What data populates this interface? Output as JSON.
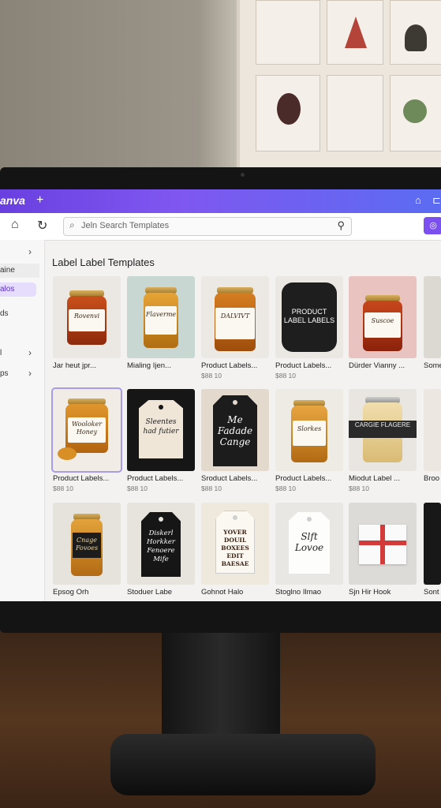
{
  "app": {
    "brand": "anva",
    "new_tab": "+",
    "title_icons": [
      "home-icon",
      "share-icon"
    ],
    "accent": "#7b4ff0"
  },
  "toolbar": {
    "home_icon": "⌂",
    "reload_icon": "↻",
    "search_placeholder": "Jeln Search Templates",
    "search_icon": "search-icon"
  },
  "sidebar": {
    "items": [
      {
        "label": "",
        "chevron": "›"
      },
      {
        "label": "aine",
        "chevron": ""
      },
      {
        "label": "alos",
        "chevron": ""
      },
      {
        "label": "ds",
        "chevron": ""
      },
      {
        "label": "l",
        "chevron": "›"
      },
      {
        "label": "ps",
        "chevron": "›"
      }
    ]
  },
  "main": {
    "heading": "Label Label Templates",
    "cards": [
      {
        "title": "Jar heut jpr...",
        "price": "",
        "art": "Rovenvi"
      },
      {
        "title": "Mialing Ijen...",
        "price": "",
        "art": "Flaverme"
      },
      {
        "title": "Product Labels...",
        "price": "$88 10",
        "art": "DALVIVT"
      },
      {
        "title": "Product Labels...",
        "price": "$88 10",
        "art": "PRODUCT LABEL LABELS"
      },
      {
        "title": "Dürder Vianny ...",
        "price": "",
        "art": "Suscoe"
      },
      {
        "title": "Some",
        "price": "",
        "art": ""
      },
      {
        "title": "Product Labels...",
        "price": "$88 10",
        "art": "Wooloker Honey"
      },
      {
        "title": "Product Labels...",
        "price": "$88 10",
        "art": "Sleentes had futier"
      },
      {
        "title": "Sroduct Labels...",
        "price": "$88 10",
        "art": "Me Fadade Cange"
      },
      {
        "title": "Product Labels...",
        "price": "$88 10",
        "art": "Slorkes"
      },
      {
        "title": "Miodut Label ...",
        "price": "$88 10",
        "art": "CARGIE FLAGERE"
      },
      {
        "title": "Broo",
        "price": "",
        "art": ""
      },
      {
        "title": "Epsog Orh",
        "price": "",
        "art": "Cnage Fovoes"
      },
      {
        "title": "Stoduer Labe",
        "price": "",
        "art": "Diskerl Horkker Fenoere Mife"
      },
      {
        "title": "Gohnot Halo",
        "price": "",
        "art": "YOVER DOUIL BOXEES EDIT BAESAE"
      },
      {
        "title": "Stoglno Ilmao",
        "price": "",
        "art": "Slft Lovoe"
      },
      {
        "title": "Sjn Hir Hook",
        "price": "",
        "art": ""
      },
      {
        "title": "Sont",
        "price": "",
        "art": ""
      }
    ]
  }
}
